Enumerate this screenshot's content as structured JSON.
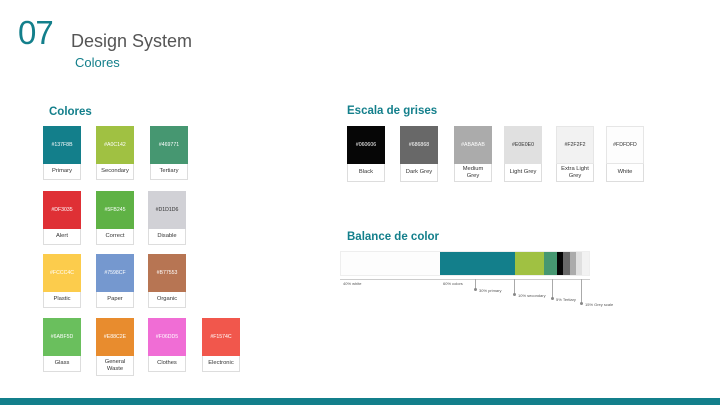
{
  "header": {
    "number": "07",
    "title": "Design System",
    "subtitle": "Colores"
  },
  "colores": {
    "title": "Colores",
    "swatches": [
      {
        "hex": "#137F8B",
        "name": "Primary",
        "color": "#137F8B"
      },
      {
        "hex": "#A0C142",
        "name": "Secondary",
        "color": "#A0C142"
      },
      {
        "hex": "#469771",
        "name": "Tertiary",
        "color": "#469771"
      },
      {
        "hex": "#DF3035",
        "name": "Alert",
        "color": "#DF3035"
      },
      {
        "hex": "#5FB245",
        "name": "Correct",
        "color": "#5FB245"
      },
      {
        "hex": "#D1D1D6",
        "name": "Disable",
        "color": "#D1D1D6"
      },
      {
        "hex": "#FCCC4C",
        "name": "Plastic",
        "color": "#FCCC4C"
      },
      {
        "hex": "#7598CF",
        "name": "Paper",
        "color": "#7598CF"
      },
      {
        "hex": "#B77553",
        "name": "Organic",
        "color": "#B77553"
      },
      {
        "hex": "#6ABF5D",
        "name": "Glass",
        "color": "#6ABF5D"
      },
      {
        "hex": "#E88C2E",
        "name": "General Waste",
        "color": "#E88C2E"
      },
      {
        "hex": "#F06DD5",
        "name": "Clothes",
        "color": "#F06DD5"
      },
      {
        "hex": "#F1574C",
        "name": "Electronic",
        "color": "#F1574C"
      }
    ]
  },
  "grises": {
    "title": "Escala de grises",
    "swatches": [
      {
        "hex": "#060606",
        "name": "Black",
        "color": "#060606"
      },
      {
        "hex": "#686868",
        "name": "Dark Grey",
        "color": "#686868"
      },
      {
        "hex": "#ABABAB",
        "name": "Medium Grey",
        "color": "#ABABAB"
      },
      {
        "hex": "#E0E0E0",
        "name": "Light Grey",
        "color": "#E0E0E0"
      },
      {
        "hex": "#F2F2F2",
        "name": "Extra Light Grey",
        "color": "#F2F2F2"
      },
      {
        "hex": "#FDFDFD",
        "name": "White",
        "color": "#FDFDFD"
      }
    ]
  },
  "balance": {
    "title": "Balance de color",
    "segments": [
      {
        "pct": 40,
        "color": "#FDFDFD"
      },
      {
        "pct": 30,
        "color": "#137F8B"
      },
      {
        "pct": 12,
        "color": "#A0C142"
      },
      {
        "pct": 5,
        "color": "#469771"
      },
      {
        "pct": 2.6,
        "color": "#060606"
      },
      {
        "pct": 2.6,
        "color": "#686868"
      },
      {
        "pct": 2.6,
        "color": "#ABABAB"
      },
      {
        "pct": 2.6,
        "color": "#E0E0E0"
      },
      {
        "pct": 2.6,
        "color": "#F2F2F2"
      }
    ],
    "labels": {
      "white": "40% white",
      "colors": "60% colors",
      "primary": "30% primary",
      "secondary": "10% secondary",
      "tertiary": "5% Tertiary",
      "grey": "15% Grey scale"
    }
  },
  "theme": {
    "accent": "#137F8B"
  }
}
